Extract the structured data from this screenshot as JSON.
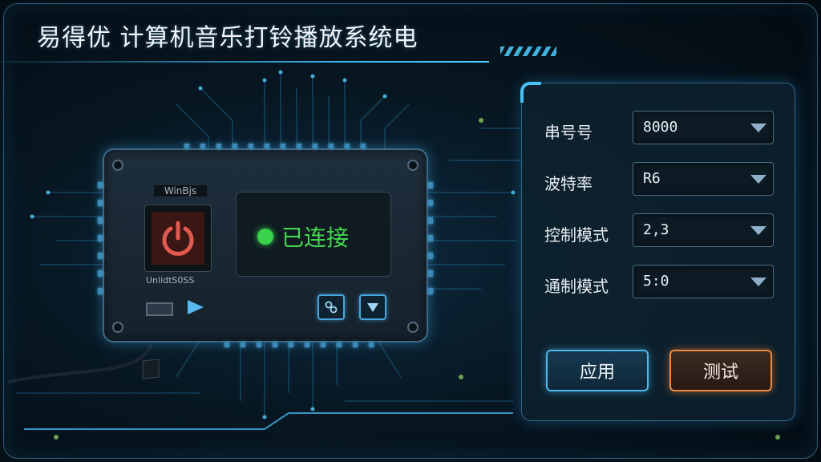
{
  "window": {
    "title": "易得优 计算机音乐打铃播放系统电"
  },
  "device": {
    "label_top": "WinBjs",
    "label_bottom": "UnlidtS0SS",
    "status_text": "已连接"
  },
  "settings": {
    "rows": [
      {
        "label": "串号号",
        "value": "8000"
      },
      {
        "label": "波特率",
        "value": "R6"
      },
      {
        "label": "控制模式",
        "value": "2,3"
      },
      {
        "label": "通制模式",
        "value": "5:0"
      }
    ],
    "apply_label": "应用",
    "test_label": "测试"
  },
  "colors": {
    "accent": "#47c0f3",
    "status_green": "#43d84d",
    "test_orange": "#f0893c",
    "power_red": "#e05a4e"
  },
  "icons": [
    "power-icon",
    "status-dot",
    "usb-port-icon",
    "play-icon",
    "link-icon",
    "down-arrow-icon",
    "dropdown-arrow-icon"
  ]
}
